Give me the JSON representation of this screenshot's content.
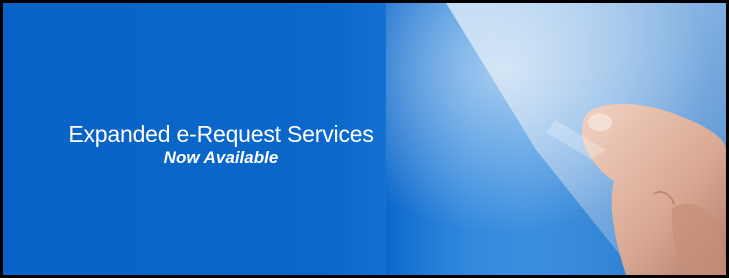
{
  "banner": {
    "headline": "Expanded e-Request Services",
    "subline": "Now Available",
    "colors": {
      "background": "#0a63c6",
      "text": "#ffffff",
      "border": "#000000"
    },
    "image_subject": "finger touching tablet screen"
  }
}
